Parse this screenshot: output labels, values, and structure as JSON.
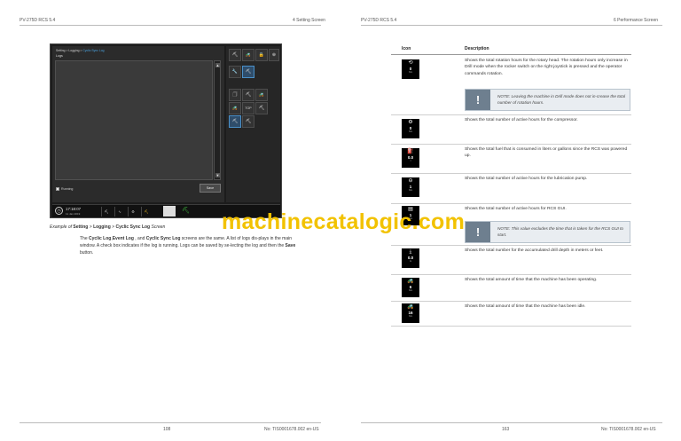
{
  "header": {
    "left_doc": "PV-275D RCS 5.4",
    "left_section": "4 Setting Screen",
    "right_doc": "PV-275D RCS 5.4",
    "right_section": "6 Performance Screen"
  },
  "screen": {
    "breadcrumb_prefix": "Setting > Logging > ",
    "breadcrumb_current": "Cyclic Sync Log",
    "logs_title": "Logs",
    "scroll_up": "▲",
    "scroll_down": "▼",
    "running_label": "Running",
    "save_label": "Save",
    "side_tiles": [
      "⛏",
      "🚜",
      "🔒",
      "⊕",
      "🔧",
      "⛏",
      "🗍",
      "⛏",
      "🚜",
      "🚜",
      "TOP",
      "⛏",
      "⛏",
      "⛏"
    ],
    "status": {
      "time": "17:18:07",
      "date": "11 Jan 2019",
      "cells": [
        "⛏",
        "∿",
        "⚙",
        "⛏"
      ],
      "green_icon": "⛏"
    }
  },
  "caption": {
    "prefix": "Example of ",
    "item1": "Setting",
    "sep1": " > ",
    "item2": "Logging",
    "sep2": " > ",
    "item3": "Cyclic Sync Log",
    "suffix": " Screen"
  },
  "paragraph": {
    "t1": "The ",
    "b1": "Cyclic Log",
    "t2": ",",
    "b2": "Event Log",
    "t3": " , and ",
    "b3": "Cyclic Sync Log",
    "t4": " screens are the same. A list of logs dis-plays in the main window. A check box indicates if the log is running. Logs can be saved by se-lecting the log and then the ",
    "b4": "Save",
    "t5": " button."
  },
  "table": {
    "col_icon": "Icon",
    "col_desc": "Description",
    "rows": [
      {
        "glyph": "⟲",
        "value": "0",
        "unit": "hrs",
        "desc": "Shows the total rotation hours for the rotary head. The rotation hours only increase in Drill mode when the rocker switch on the right joystick is pressed and the operator commands rotation."
      },
      {
        "glyph": "⚙",
        "value": "0",
        "unit": "hrs",
        "desc": "Shows the total number of active hours for the compressor."
      },
      {
        "glyph": "⛽",
        "value": "0.0",
        "unit": "l",
        "desc": "Shows the total fuel that is consumed in liters or gallons since the RCS was powered up."
      },
      {
        "glyph": "⊖",
        "value": "1",
        "unit": "hrs",
        "desc": "Shows the total number of active hours for the lubrication pump."
      },
      {
        "glyph": "▤",
        "value": "1",
        "unit": "hrs",
        "desc": "Shows the total number of active hours for RCS GUI."
      },
      {
        "glyph": "⤓",
        "value": "0.0",
        "unit": "m",
        "desc": "Shows the total number for the accumulated drill depth in meters or feet."
      },
      {
        "glyph": "🚜",
        "value": "6",
        "unit": "hrs",
        "desc": "Shows the total amount of time that the machine has been operating."
      },
      {
        "glyph": "🚜",
        "value": "16",
        "unit": "hrs",
        "desc": "Shows the total amount of time that the machine has been idle."
      }
    ],
    "note1": "NOTE: Leaving the machine in Drill mode does not in-crease the total number of rotation hours.",
    "note2": "NOTE: This value excludes the time that is taken for the RCS GUI to start.",
    "note_mark": "!"
  },
  "footer": {
    "left_page": "108",
    "left_doc_no": "No: TIS0001678.002 en-US",
    "right_page": "163",
    "right_doc_no": "No: TIS0001678.002 en-US"
  },
  "watermark": "machinecatalogic.com",
  "colors": {
    "watermark": "#f2c200",
    "note_mark": "#6e7f8f",
    "accent_blue": "#4aa3e0"
  }
}
